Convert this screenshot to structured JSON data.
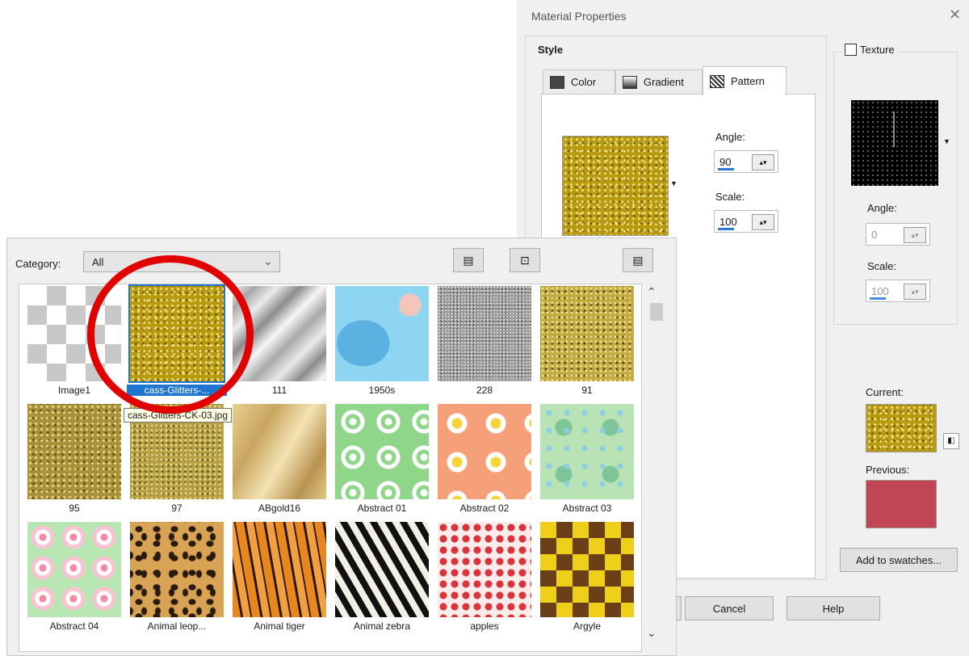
{
  "dialog": {
    "title": "Material Properties",
    "close_glyph": "✕",
    "style_legend": "Style",
    "tabs": [
      {
        "label": "Color",
        "icon": "color-swatch-icon"
      },
      {
        "label": "Gradient",
        "icon": "gradient-icon"
      },
      {
        "label": "Pattern",
        "icon": "pattern-icon",
        "active": true
      }
    ],
    "pattern": {
      "angle_label": "Angle:",
      "angle_value": "90",
      "scale_label": "Scale:",
      "scale_value": "100"
    },
    "texture": {
      "checkbox_label": "Texture",
      "checked": false,
      "angle_label": "Angle:",
      "angle_value": "0",
      "scale_label": "Scale:",
      "scale_value": "100"
    },
    "current_label": "Current:",
    "previous_label": "Previous:",
    "previous_color": "#c04656",
    "add_swatches_label": "Add to swatches...",
    "cancel_label": "Cancel",
    "help_label": "Help"
  },
  "picker": {
    "category_label": "Category:",
    "category_value": "All",
    "toolbar_icons": [
      "view-icon",
      "window-icon",
      "options-icon"
    ],
    "tooltip": "cass-Glitters-CK-03.jpg",
    "selected_index": 1,
    "items": [
      {
        "label": "Image1",
        "texture": "check"
      },
      {
        "label": "cass-Glitters-...",
        "texture": "gold"
      },
      {
        "label": "111",
        "texture": "silver"
      },
      {
        "label": "1950s",
        "texture": "1950s"
      },
      {
        "label": "228",
        "texture": "228"
      },
      {
        "label": "91",
        "texture": "91"
      },
      {
        "label": "95",
        "texture": "95"
      },
      {
        "label": "97",
        "texture": "97"
      },
      {
        "label": "ABgold16",
        "texture": "abgold"
      },
      {
        "label": "Abstract 01",
        "texture": "abs01"
      },
      {
        "label": "Abstract 02",
        "texture": "abs02"
      },
      {
        "label": "Abstract 03",
        "texture": "abs03"
      },
      {
        "label": "Abstract 04",
        "texture": "abs04"
      },
      {
        "label": "Animal leop...",
        "texture": "leopard"
      },
      {
        "label": "Animal tiger",
        "texture": "tiger"
      },
      {
        "label": "Animal zebra",
        "texture": "zebra"
      },
      {
        "label": "apples",
        "texture": "apples"
      },
      {
        "label": "Argyle",
        "texture": "argyle"
      }
    ]
  },
  "annotation": {
    "color": "#e10000"
  }
}
